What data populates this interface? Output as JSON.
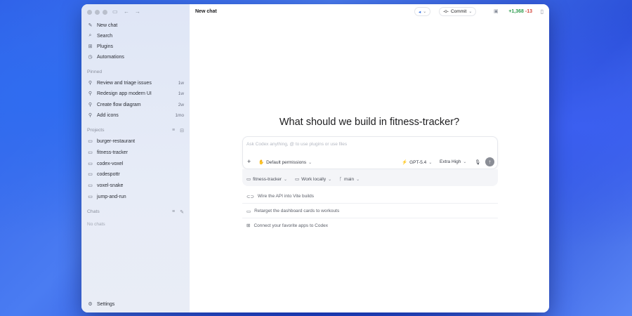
{
  "sidebar": {
    "nav": [
      {
        "label": "New chat",
        "icon": "edit-icon"
      },
      {
        "label": "Search",
        "icon": "search-icon"
      },
      {
        "label": "Plugins",
        "icon": "plugins-icon"
      },
      {
        "label": "Automations",
        "icon": "clock-icon"
      }
    ],
    "pinned_label": "Pinned",
    "pinned": [
      {
        "label": "Review and triage issues",
        "age": "1w"
      },
      {
        "label": "Redesign app modern UI",
        "age": "1w"
      },
      {
        "label": "Create flow diagram",
        "age": "2w"
      },
      {
        "label": "Add icons",
        "age": "1mo"
      }
    ],
    "projects_label": "Projects",
    "projects": [
      {
        "label": "burger-restaurant"
      },
      {
        "label": "fitness-tracker"
      },
      {
        "label": "codex-voxel"
      },
      {
        "label": "codespottr"
      },
      {
        "label": "voxel-snake"
      },
      {
        "label": "jump-and-run"
      }
    ],
    "chats_label": "Chats",
    "chats_empty": "No chats",
    "settings_label": "Settings"
  },
  "topbar": {
    "title": "New chat",
    "commit_label": "Commit",
    "diff_added": "+1,368",
    "diff_removed": "-13"
  },
  "main": {
    "heading": "What should we build in fitness-tracker?",
    "composer_placeholder": "Ask Codex anything, @ to use plugins or use files",
    "permissions_label": "Default permissions",
    "model_label": "GPT-5.4",
    "effort_label": "Extra High",
    "project_label": "fitness-tracker",
    "workspace_label": "Work locally",
    "branch_label": "main",
    "suggestions": [
      {
        "label": "Wire the API into Vite builds",
        "icon": "link-icon"
      },
      {
        "label": "Retarget the dashboard cards to workouts",
        "icon": "cards-icon"
      },
      {
        "label": "Connect your favorite apps to Codex",
        "icon": "apps-grid-icon"
      }
    ]
  },
  "colors": {
    "accent_added": "#2e9d4f",
    "accent_removed": "#d4473d",
    "sidebar_bg": "#e3e9f6"
  }
}
